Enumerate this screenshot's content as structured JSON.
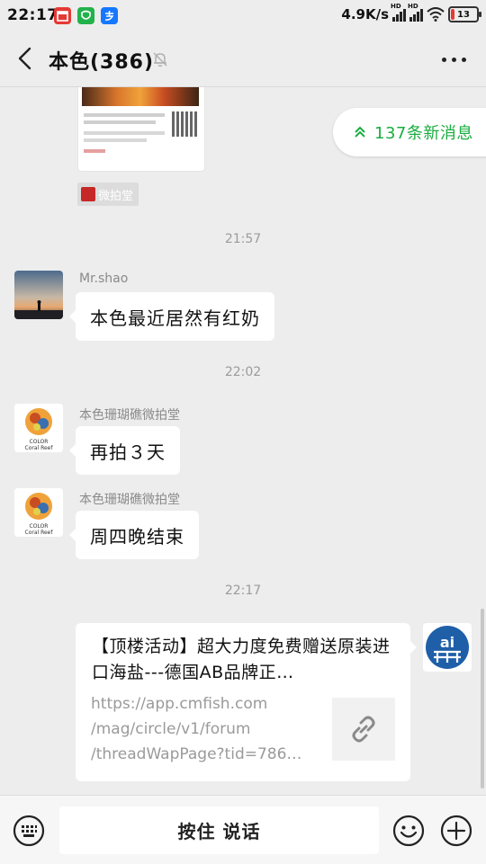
{
  "status_bar": {
    "time": "22:17",
    "app_icons": [
      {
        "name": "calendar-app-icon",
        "color": "#e53935",
        "glyph": "▣"
      },
      {
        "name": "shield-app-icon",
        "color": "#22b24c",
        "glyph": "◎"
      },
      {
        "name": "alipay-app-icon",
        "color": "#1677ff",
        "glyph": "支"
      }
    ],
    "network_speed": "4.9K/s",
    "battery_level": "13"
  },
  "header": {
    "title": "本色(386)",
    "muted": true
  },
  "chat": {
    "share_card": {
      "source_label": "微拍堂"
    },
    "new_messages_label": "137条新消息",
    "messages": [
      {
        "type": "time",
        "text": "21:57"
      },
      {
        "type": "msg",
        "sender": "Mr.shao",
        "text": "本色最近居然有红奶",
        "avatar": "sunset-avatar"
      },
      {
        "type": "time",
        "text": "22:02"
      },
      {
        "type": "msg",
        "sender": "本色珊瑚礁微拍堂",
        "text": "再拍３天",
        "avatar": "coral-reef-avatar"
      },
      {
        "type": "msg",
        "sender": "本色珊瑚礁微拍堂",
        "text": "周四晚结束",
        "avatar": "coral-reef-avatar"
      },
      {
        "type": "time",
        "text": "22:17"
      }
    ],
    "link_message": {
      "title": "【顶楼活动】超大力度免费赠送原装进口海盐---德国AB品牌正…",
      "url_lines": [
        "https://app.cmfish.com",
        "/mag/circle/v1/forum",
        "/threadWapPage?tid=786…"
      ],
      "avatar": "ai-logo-avatar"
    }
  },
  "input_bar": {
    "talk_label": "按住 说话"
  },
  "colors": {
    "accent_green": "#1aad3f",
    "background": "#ededed"
  }
}
